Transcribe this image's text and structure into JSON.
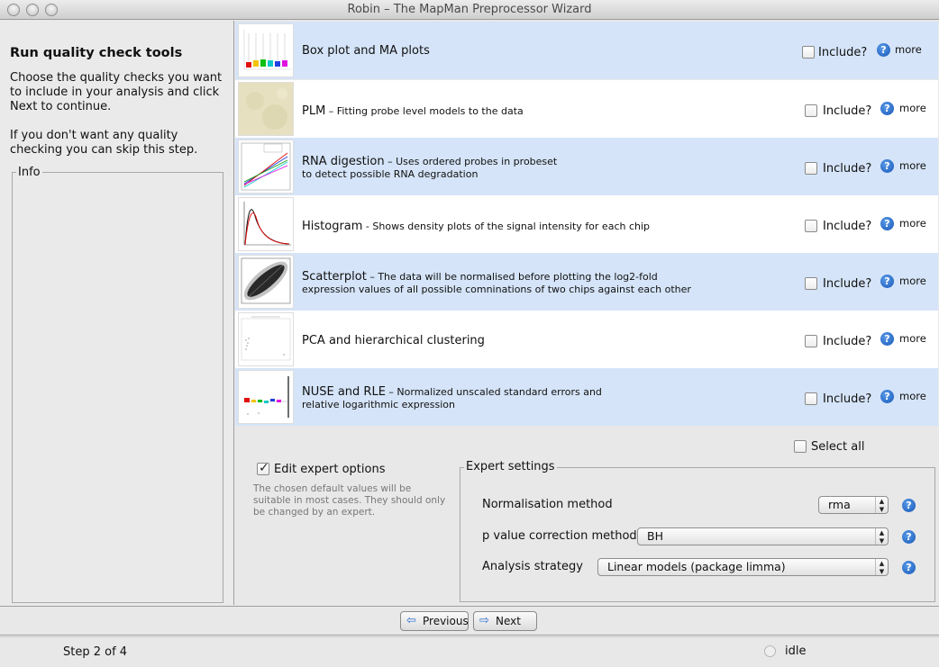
{
  "window": {
    "title": "Robin – The MapMan Preprocessor Wizard"
  },
  "left": {
    "heading": "Run quality check tools",
    "intro": "Choose the quality checks you want to include in your analysis and click Next to continue.",
    "skip": "If you don't want any quality checking you can skip this step.",
    "info_legend": "Info"
  },
  "checks": [
    {
      "title": "Box plot and MA plots",
      "subtitle": "",
      "line2": "",
      "include_label": "Include?",
      "include": false,
      "more": "more",
      "thumb_icon": "boxplot-thumbnail"
    },
    {
      "title": "PLM",
      "subtitle": " – Fitting probe level models to the data",
      "line2": "",
      "include_label": "Include?",
      "include": false,
      "more": "more",
      "thumb_icon": "plm-image-thumbnail"
    },
    {
      "title": "RNA digestion",
      "subtitle": " – Uses ordered probes in probeset",
      "line2": "to detect possible RNA degradation",
      "include_label": "Include?",
      "include": false,
      "more": "more",
      "thumb_icon": "rna-degradation-thumbnail"
    },
    {
      "title": "Histogram",
      "subtitle": " - Shows density plots of the signal intensity for each chip",
      "line2": "",
      "include_label": "Include?",
      "include": false,
      "more": "more",
      "thumb_icon": "histogram-thumbnail"
    },
    {
      "title": "Scatterplot",
      "subtitle": " – The data will be normalised before plotting the log2-fold",
      "line2": "expression values of all possible comninations of two chips against each other",
      "include_label": "Include?",
      "include": false,
      "more": "more",
      "thumb_icon": "scatterplot-thumbnail"
    },
    {
      "title": "PCA and hierarchical clustering",
      "subtitle": "",
      "line2": "",
      "include_label": "Include?",
      "include": false,
      "more": "more",
      "thumb_icon": "pca-thumbnail"
    },
    {
      "title": "NUSE and RLE",
      "subtitle": " – Normalized unscaled standard errors and",
      "line2": "relative logarithmic expression",
      "include_label": "Include?",
      "include": false,
      "more": "more",
      "thumb_icon": "nuse-rle-thumbnail"
    }
  ],
  "select_all": {
    "label": "Select all",
    "checked": false
  },
  "expert": {
    "label": "Edit expert options",
    "checked": true,
    "note": "The chosen default values will be suitable in most cases. They should only be changed by an expert."
  },
  "settings": {
    "legend": "Expert settings",
    "normalisation_label": "Normalisation method",
    "normalisation_value": "rma",
    "pvalue_label": "p value correction method",
    "pvalue_value": "BH",
    "strategy_label": "Analysis strategy",
    "strategy_value": "Linear models (package limma)"
  },
  "nav": {
    "previous": "Previous",
    "next": "Next"
  },
  "status": {
    "step": "Step 2 of 4",
    "state": "idle"
  },
  "colors": {
    "row_blue": "#d5e4f8",
    "row_white": "#ffffff",
    "help_blue": "#1657b8"
  }
}
